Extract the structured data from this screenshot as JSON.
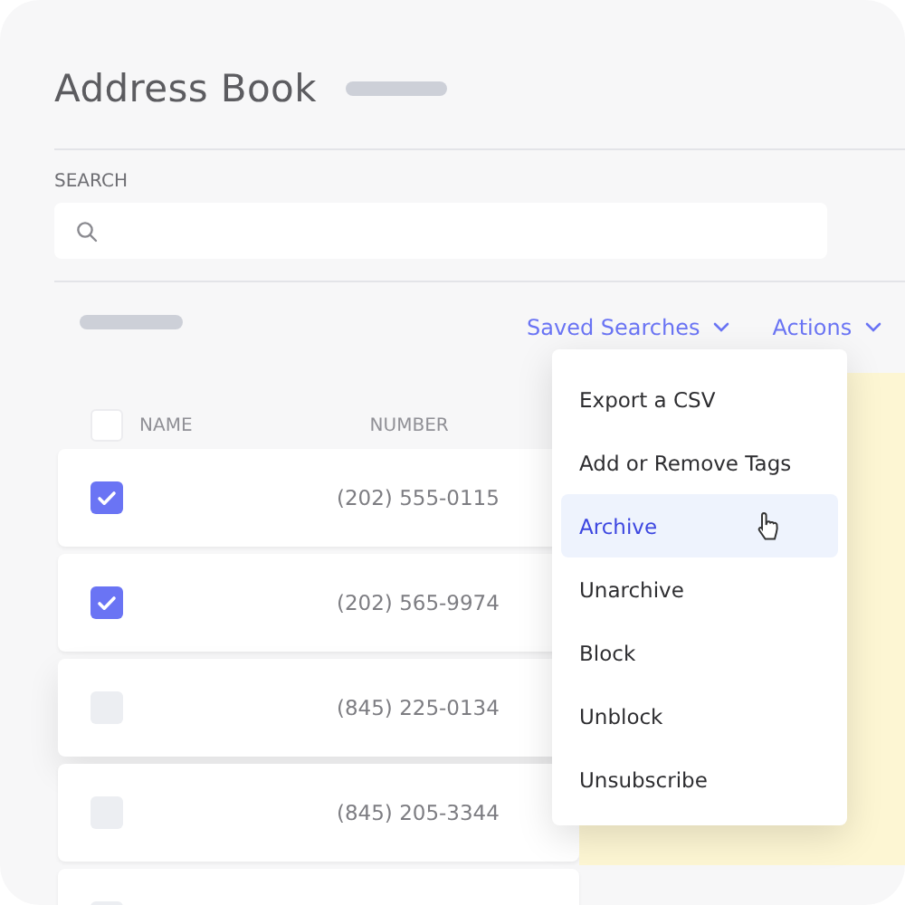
{
  "title": "Address Book",
  "search": {
    "label": "SEARCH"
  },
  "toolbar": {
    "saved_searches": "Saved Searches",
    "actions": "Actions"
  },
  "table": {
    "header_checked": false,
    "columns": [
      "NAME",
      "NUMBER"
    ],
    "rows": [
      {
        "checked": true,
        "number": "(202) 555-0115"
      },
      {
        "checked": true,
        "number": "(202) 565-9974"
      },
      {
        "checked": false,
        "number": "(845) 225-0134"
      },
      {
        "checked": false,
        "number": "(845) 205-3344"
      },
      {
        "checked": false
      }
    ]
  },
  "actions_menu": {
    "items": [
      {
        "label": "Export a CSV",
        "selected": false
      },
      {
        "label": "Add or Remove Tags",
        "selected": false
      },
      {
        "label": "Archive",
        "selected": true
      },
      {
        "label": "Unarchive",
        "selected": false
      },
      {
        "label": "Block",
        "selected": false
      },
      {
        "label": "Unblock",
        "selected": false
      },
      {
        "label": "Unsubscribe",
        "selected": false
      }
    ]
  }
}
